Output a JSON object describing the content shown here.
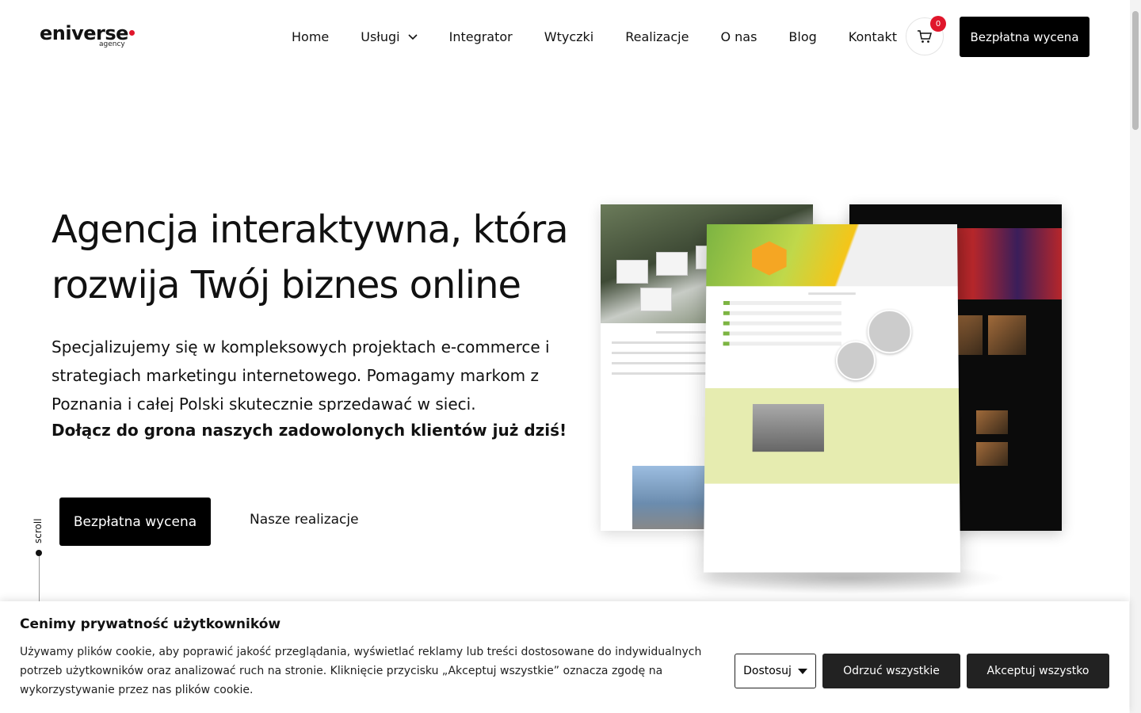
{
  "logo": {
    "main": "eniverse",
    "sub": "agency",
    "dot_color": "#e0162b"
  },
  "nav": {
    "items": [
      {
        "label": "Home"
      },
      {
        "label": "Usługi",
        "has_dropdown": true
      },
      {
        "label": "Integrator"
      },
      {
        "label": "Wtyczki"
      },
      {
        "label": "Realizacje"
      },
      {
        "label": "O nas"
      },
      {
        "label": "Blog"
      },
      {
        "label": "Kontakt"
      }
    ]
  },
  "cart": {
    "count": "0",
    "icon": "cart-icon"
  },
  "header_cta": {
    "label": "Bezpłatna wycena"
  },
  "hero": {
    "title": "Agencja interaktywna, która rozwija Twój biznes online",
    "description": "Specjalizujemy się w kompleksowych projektach e-commerce i strategiach marketingu internetowego. Pomagamy markom z Poznania i całej Polski skutecznie sprzedawać w sieci.",
    "strong": "Dołącz do grona naszych zadowolonych klientów już dziś!",
    "cta_label": "Bezpłatna wycena",
    "link_label": "Nasze realizacje",
    "scroll_label": "scroll"
  },
  "cookie": {
    "title": "Cenimy prywatność użytkowników",
    "text": "Używamy plików cookie, aby poprawić jakość przeglądania, wyświetlać reklamy lub treści dostosowane do indywidualnych potrzeb użytkowników oraz analizować ruch na stronie. Kliknięcie przycisku „Akceptuj wszystkie” oznacza zgodę na wykorzystywanie przez nas plików cookie.",
    "customize_label": "Dostosuj",
    "reject_label": "Odrzuć wszystkie",
    "accept_label": "Akceptuj wszystko"
  },
  "colors": {
    "accent": "#000000",
    "badge": "#e0162b",
    "brand_green": "#7cb442"
  }
}
